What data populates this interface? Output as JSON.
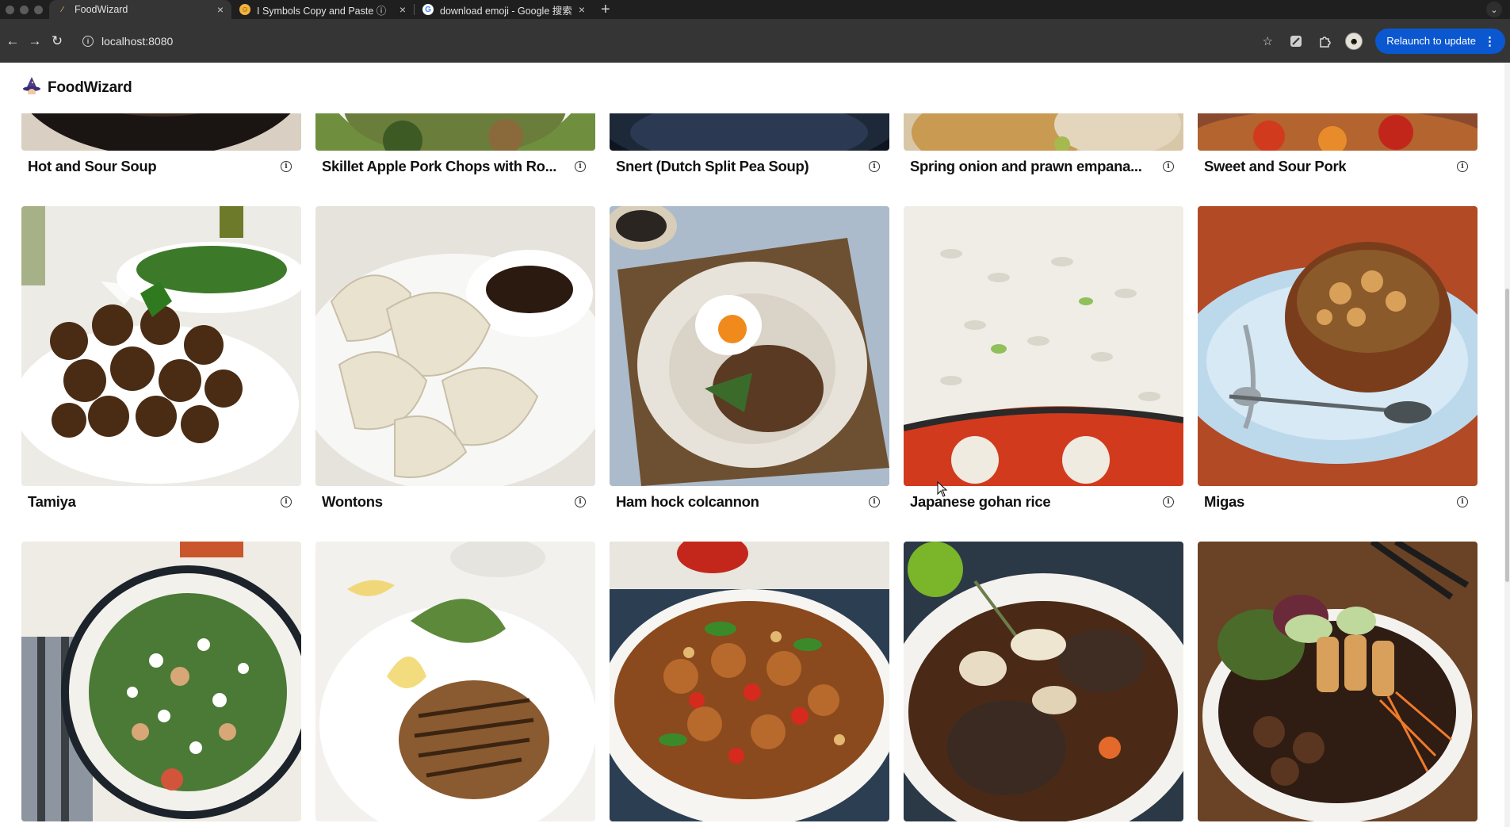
{
  "browser": {
    "tabs": [
      {
        "title": "FoodWizard",
        "icon": "wand-favicon",
        "active": true
      },
      {
        "title": "I Symbols Copy and Paste ⓘ",
        "icon": "smiley-favicon",
        "active": false
      },
      {
        "title": "download emoji - Google 搜索",
        "icon": "google-favicon",
        "active": false
      }
    ],
    "url": "localhost:8080",
    "relaunch_label": "Relaunch to update"
  },
  "app": {
    "brand": "FoodWizard"
  },
  "recipes": {
    "row1": [
      {
        "name": "Hot and Sour Soup"
      },
      {
        "name": "Skillet Apple Pork Chops with Ro..."
      },
      {
        "name": "Snert (Dutch Split Pea Soup)"
      },
      {
        "name": "Spring onion and prawn empana..."
      },
      {
        "name": "Sweet and Sour Pork"
      }
    ],
    "row2": [
      {
        "name": "Tamiya"
      },
      {
        "name": "Wontons"
      },
      {
        "name": "Ham hock colcannon"
      },
      {
        "name": "Japanese gohan rice"
      },
      {
        "name": "Migas"
      }
    ],
    "row3": [
      {
        "name": ""
      },
      {
        "name": ""
      },
      {
        "name": ""
      },
      {
        "name": ""
      },
      {
        "name": ""
      }
    ]
  },
  "colors": {
    "accent": "#0b57d0",
    "chrome_dark": "#1f1f1f",
    "toolbar": "#353535"
  }
}
